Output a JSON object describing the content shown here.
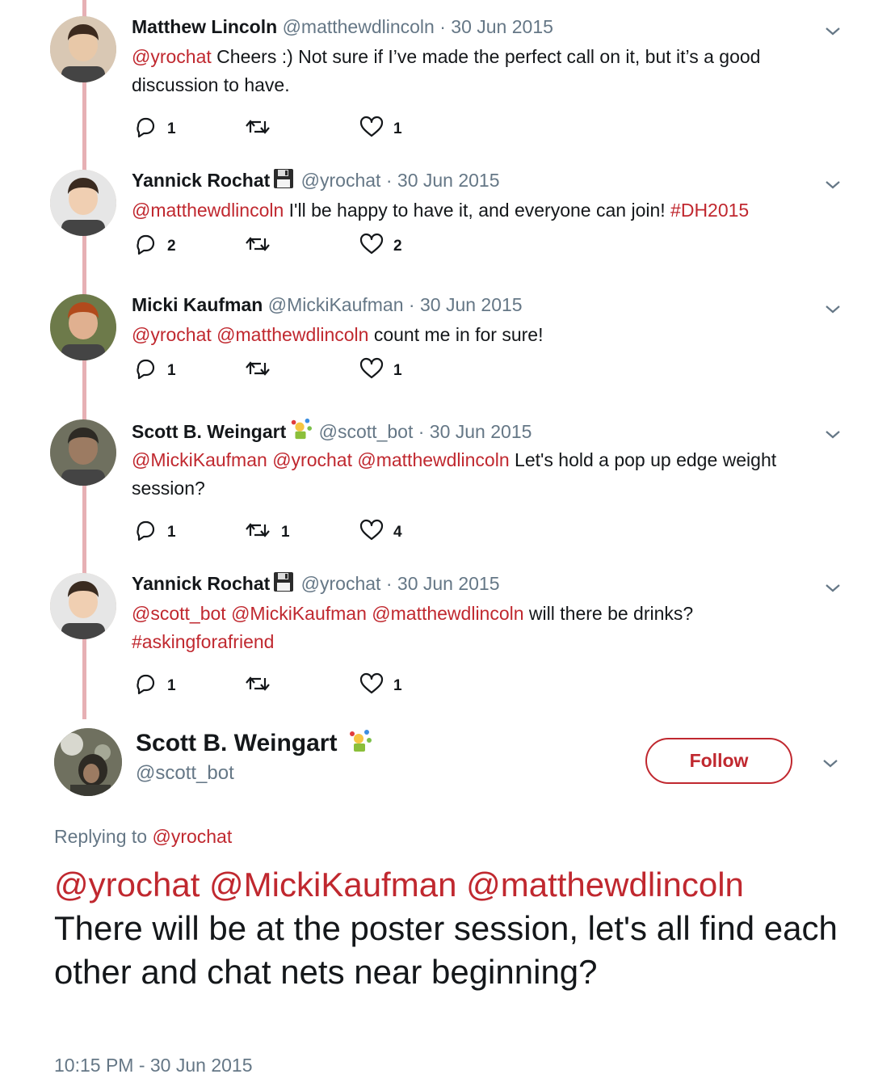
{
  "colors": {
    "link": "#c0282f",
    "muted": "#657786",
    "thread_line": "#e6b0b4"
  },
  "thread": [
    {
      "name": "Matthew Lincoln",
      "badge": "",
      "handle": "@matthewdlincoln",
      "date": "30 Jun 2015",
      "body": [
        {
          "t": "@yrochat",
          "link": true
        },
        {
          "t": " Cheers :) Not sure if I’ve made the perfect call on it, but it’s a good discussion to have."
        }
      ],
      "replies": "1",
      "retweets": "",
      "likes": "1"
    },
    {
      "name": "Yannick Rochat",
      "badge": "floppy-disk-icon",
      "handle": "@yrochat",
      "date": "30 Jun 2015",
      "body": [
        {
          "t": "@matthewdlincoln",
          "link": true
        },
        {
          "t": " I'll be happy to have it, and everyone can join! "
        },
        {
          "t": "#DH2015",
          "link": true
        }
      ],
      "replies": "2",
      "retweets": "",
      "likes": "2"
    },
    {
      "name": "Micki Kaufman",
      "badge": "",
      "handle": "@MickiKaufman",
      "date": "30 Jun 2015",
      "body": [
        {
          "t": "@yrochat",
          "link": true
        },
        {
          "t": " "
        },
        {
          "t": "@matthewdlincoln",
          "link": true
        },
        {
          "t": " count me in for sure!"
        }
      ],
      "replies": "1",
      "retweets": "",
      "likes": "1"
    },
    {
      "name": "Scott B. Weingart",
      "badge": "juggler-emoji-icon",
      "handle": "@scott_bot",
      "date": "30 Jun 2015",
      "body": [
        {
          "t": "@MickiKaufman",
          "link": true
        },
        {
          "t": " "
        },
        {
          "t": "@yrochat",
          "link": true
        },
        {
          "t": " "
        },
        {
          "t": "@matthewdlincoln",
          "link": true
        },
        {
          "t": " Let's hold a pop up edge weight session?"
        }
      ],
      "replies": "1",
      "retweets": "1",
      "likes": "4"
    },
    {
      "name": "Yannick Rochat",
      "badge": "floppy-disk-icon",
      "handle": "@yrochat",
      "date": "30 Jun 2015",
      "body": [
        {
          "t": "@scott_bot",
          "link": true
        },
        {
          "t": " "
        },
        {
          "t": "@MickiKaufman",
          "link": true
        },
        {
          "t": " "
        },
        {
          "t": "@matthewdlincoln",
          "link": true
        },
        {
          "t": " will there be drinks? "
        },
        {
          "t": "#askingforafriend",
          "link": true
        }
      ],
      "replies": "1",
      "retweets": "",
      "likes": "1"
    }
  ],
  "main": {
    "name": "Scott B. Weingart",
    "badge": "juggler-emoji-icon",
    "handle": "@scott_bot",
    "follow_label": "Follow",
    "replying_prefix": "Replying to ",
    "replying_to": "@yrochat",
    "mentions": [
      {
        "t": "@yrochat",
        "link": true
      },
      {
        "t": " "
      },
      {
        "t": "@MickiKaufman",
        "link": true
      },
      {
        "t": " "
      },
      {
        "t": "@matthewdlincoln",
        "link": true
      }
    ],
    "text": "There will be at the poster session, let's all find each other and chat nets near beginning?",
    "timestamp": "10:15 PM - 30 Jun 2015"
  }
}
